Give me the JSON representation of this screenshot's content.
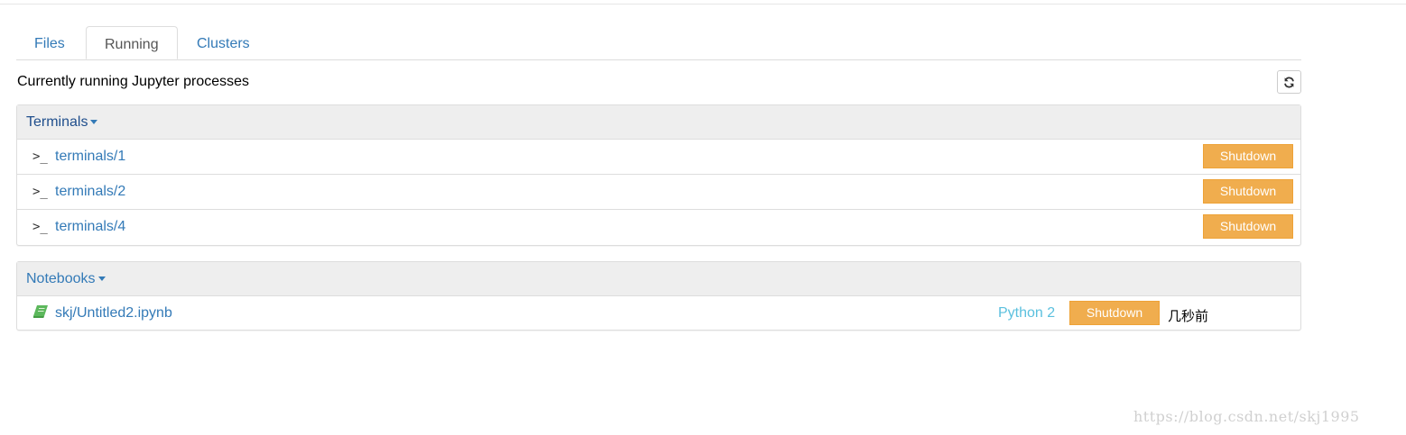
{
  "tabs": [
    {
      "label": "Files"
    },
    {
      "label": "Running"
    },
    {
      "label": "Clusters"
    }
  ],
  "running_title": "Currently running Jupyter processes",
  "terminals": {
    "heading": "Terminals",
    "items": [
      {
        "icon": ">_",
        "name": "terminals/1",
        "action": "Shutdown"
      },
      {
        "icon": ">_",
        "name": "terminals/2",
        "action": "Shutdown"
      },
      {
        "icon": ">_",
        "name": "terminals/4",
        "action": "Shutdown"
      }
    ]
  },
  "notebooks": {
    "heading": "Notebooks",
    "items": [
      {
        "icon": "notebook-icon",
        "name": "skj/Untitled2.ipynb",
        "kernel": "Python 2",
        "action": "Shutdown",
        "modified": "几秒前"
      }
    ]
  },
  "watermark": "https://blog.csdn.net/skj1995",
  "colors": {
    "link": "#337ab7",
    "warning_button": "#f0ad4e",
    "kernel_text": "#5bc0de",
    "notebook_icon": "#5cb85c"
  }
}
